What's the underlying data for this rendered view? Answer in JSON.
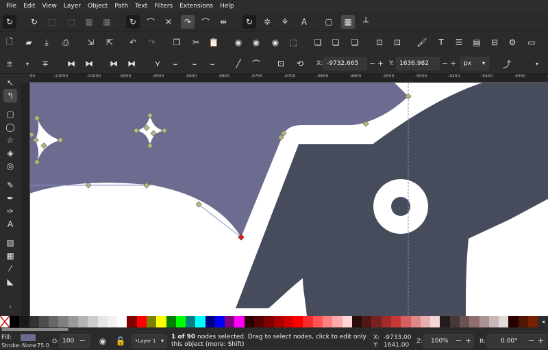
{
  "menu": [
    "File",
    "Edit",
    "View",
    "Layer",
    "Object",
    "Path",
    "Text",
    "Filters",
    "Extensions",
    "Help"
  ],
  "node_toolbar": {
    "x_label": "X:",
    "x_value": "-9732.665",
    "y_label": "Y:",
    "y_value": "1636.982",
    "unit": "px",
    "minus": "−",
    "plus": "+"
  },
  "ruler_top_labels": [
    "-10100",
    "-10050",
    "-10000",
    "-9950",
    "-9900",
    "-9850",
    "-9800",
    "-9750",
    "-9700",
    "-9650",
    "-9600",
    "-9550",
    "-9500",
    "-9450",
    "-9400",
    "-9350",
    "-9300",
    "-9250",
    "-9200"
  ],
  "palette_colors": [
    "#000000",
    "#1a1a1a",
    "#333333",
    "#4d4d4d",
    "#666666",
    "#808080",
    "#999999",
    "#b3b3b3",
    "#cccccc",
    "#e6e6e6",
    "#f2f2f2",
    "#ffffff",
    "#800000",
    "#ff0000",
    "#808000",
    "#ffff00",
    "#008000",
    "#00ff00",
    "#008080",
    "#00ffff",
    "#000080",
    "#0000ff",
    "#800080",
    "#ff00ff",
    "#2b0000",
    "#550000",
    "#800000",
    "#aa0000",
    "#d40000",
    "#ff0000",
    "#ff2a2a",
    "#ff5555",
    "#ff8080",
    "#ffaaaa",
    "#ffd5d5",
    "#280b0b",
    "#501616",
    "#782121",
    "#a02c2c",
    "#c83737",
    "#d35f5f",
    "#de8787",
    "#e9afaf",
    "#f4d7d7",
    "#241c1c",
    "#483737",
    "#6c5353",
    "#916f6f",
    "#ac9393",
    "#c8b7b7",
    "#e3dbdb",
    "#280000",
    "#501600",
    "#782100"
  ],
  "colors": {
    "purple_shape": "#6c6b90",
    "dark_shape": "#474c5d",
    "selected_node": "#e01b1b",
    "node": "#b6b67a"
  },
  "status": {
    "fill_label": "Fill:",
    "fill_color": "#6c6b90",
    "stroke_label": "Stroke:",
    "stroke_value": "None",
    "stroke_width": "75.0",
    "opacity_label": "O:",
    "opacity_value": "100",
    "minus": "−",
    "layer": "•Layer 1",
    "message_bold": "1 of 90",
    "message": " nodes selected. Drag to select nodes, click to edit only this object (more: Shift)",
    "cursor_x_label": "X:",
    "cursor_x": "-9733.00",
    "cursor_y_label": "Y:",
    "cursor_y": "1641.00",
    "zoom_label": "Z:",
    "zoom": "100%",
    "rotate_label": "R:",
    "rotate": "0.00°"
  }
}
